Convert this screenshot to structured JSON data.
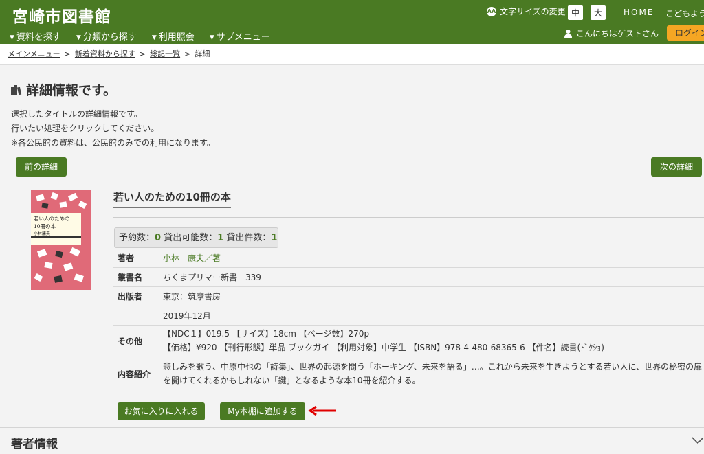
{
  "header": {
    "site_title": "宮崎市図書館",
    "nav": [
      "資料を探す",
      "分類から探す",
      "利用照会",
      "サブメニュー"
    ],
    "font_size_label": "文字サイズの変更",
    "font_size_icon": "AA",
    "size_medium": "中",
    "size_large": "大",
    "home": "HOME",
    "kids": "こどもよう",
    "greeting": "こんにちはゲストさん",
    "login": "ログイン",
    "theme_color": "#4a7a23",
    "login_color": "#f5a623"
  },
  "breadcrumb": {
    "items": [
      "メインメニュー",
      "新着資料から探す",
      "総記一覧"
    ],
    "current": "詳細",
    "separator": ">"
  },
  "main": {
    "heading": "詳細情報です。",
    "intro": [
      "選択したタイトルの詳細情報です。",
      "行いたい処理をクリックしてください。",
      "※各公民館の資料は、公民館のみでの利用になります。"
    ],
    "prev_button": "前の詳細",
    "next_button": "次の詳細"
  },
  "cover": {
    "title_line1": "若い人のための",
    "title_line2": "10冊の本",
    "author": "小林康夫"
  },
  "book": {
    "title": "若い人のための10冊の本",
    "availability": {
      "reserve_label": "予約数：",
      "reserve": "0",
      "loanable_label": "貸出可能数：",
      "loanable": "1",
      "loans_label": "貸出件数：",
      "loans": "1"
    },
    "details": {
      "author_label": "著者",
      "author": "小林　康夫／著",
      "series_label": "叢書名",
      "series": "ちくまプリマー新書　339",
      "publisher_label": "出版者",
      "publisher": "東京：筑摩書房",
      "date": "2019年12月",
      "other_label": "その他",
      "other_line1": "【NDC１】019.5 【サイズ】18cm 【ページ数】270p",
      "other_line2": "【価格】¥920 【刊行形態】単品 ブックガイ 【利用対象】中学生 【ISBN】978-4-480-68365-6 【件名】読書(ﾄﾞｸｼｮ)",
      "contents_label": "内容紹介",
      "contents_line1": "悲しみを歌う、中原中也の「詩集」、世界の起源を問う「ホーキング、未来を語る」…。これから未来を生きようとする若い人に、世界の秘密の扉",
      "contents_line2": "を開けてくれるかもしれない「鍵」となるような本10冊を紹介する。"
    },
    "favorite_button": "お気に入りに入れる",
    "shelf_button": "My本棚に追加する"
  },
  "author_section": {
    "heading": "著者情報"
  }
}
